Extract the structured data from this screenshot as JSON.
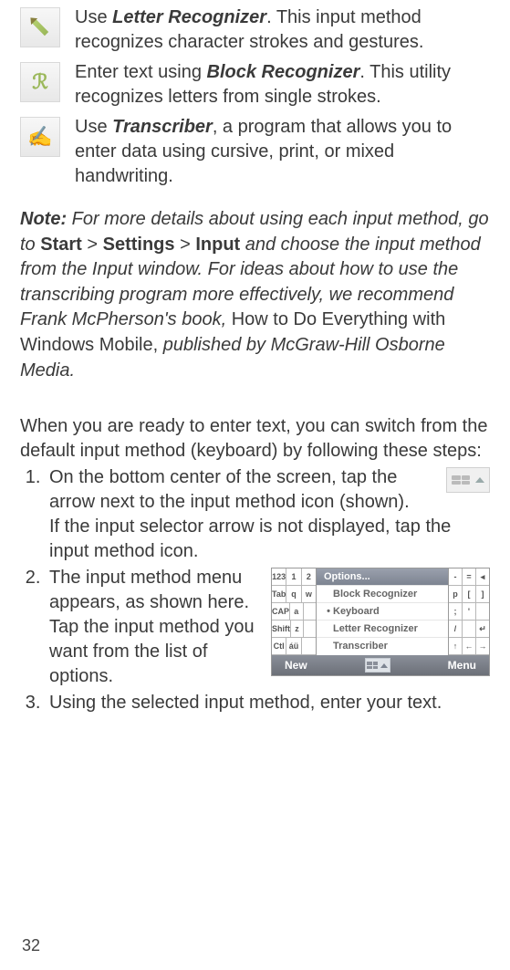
{
  "methods": [
    {
      "pre": "Use ",
      "name": "Letter Recognizer",
      "post": ". This input method recognizes character strokes and gestures.",
      "icon": "letter-recognizer-icon"
    },
    {
      "pre": "Enter text using ",
      "name": "Block Recognizer",
      "post": ". This utility recognizes letters from single strokes.",
      "icon": "block-recognizer-icon"
    },
    {
      "pre": "Use ",
      "name": "Transcriber",
      "post": ", a program that allows you to enter data using cursive, print, or mixed handwriting.",
      "icon": "transcriber-icon"
    }
  ],
  "note": {
    "label": "Note:",
    "seg1": " For more details about using each input method, go to ",
    "start": "Start",
    "gt1": "  > ",
    "settings": "Settings",
    "gt2": " > ",
    "input": "Input",
    "seg2": " and choose the input method from the Input window. For ideas about how to use the transcribing program more effectively, we recommend Frank McPherson's book, ",
    "book": "How to Do Everything with Windows Mobile, ",
    "seg3": "published by McGraw-Hill Osborne Media."
  },
  "para": "When you are ready to enter text, you can switch from the default input method (keyboard) by following these steps:",
  "steps": {
    "s1a": "On the bottom center of the screen, tap the arrow next to the input method icon (shown).",
    "s1b": "If the input selector arrow is not displayed, tap the input method icon.",
    "s2": "The input method menu appears, as shown here. Tap the input method you want from the list of options.",
    "s3": "Using the selected input method, enter your text."
  },
  "screenshot": {
    "keys_left": [
      [
        "123",
        "1",
        "2"
      ],
      [
        "Tab",
        "q",
        "w"
      ],
      [
        "CAP",
        "a",
        ""
      ],
      [
        "Shift",
        "z",
        ""
      ],
      [
        "Ctl",
        "áü",
        ""
      ]
    ],
    "keys_right": [
      [
        "-",
        "=",
        "◂"
      ],
      [
        "p",
        "[",
        "]"
      ],
      [
        ";",
        "'",
        ""
      ],
      [
        "/",
        "",
        "↵"
      ],
      [
        "↑",
        "←",
        "→"
      ]
    ],
    "menu_header": "Options...",
    "menu_items": [
      {
        "bullet": "",
        "label": "Block Recognizer"
      },
      {
        "bullet": "•",
        "label": "Keyboard"
      },
      {
        "bullet": "",
        "label": "Letter Recognizer"
      },
      {
        "bullet": "",
        "label": "Transcriber"
      }
    ],
    "bar_left": "New",
    "bar_right": "Menu"
  },
  "page_number": "32"
}
